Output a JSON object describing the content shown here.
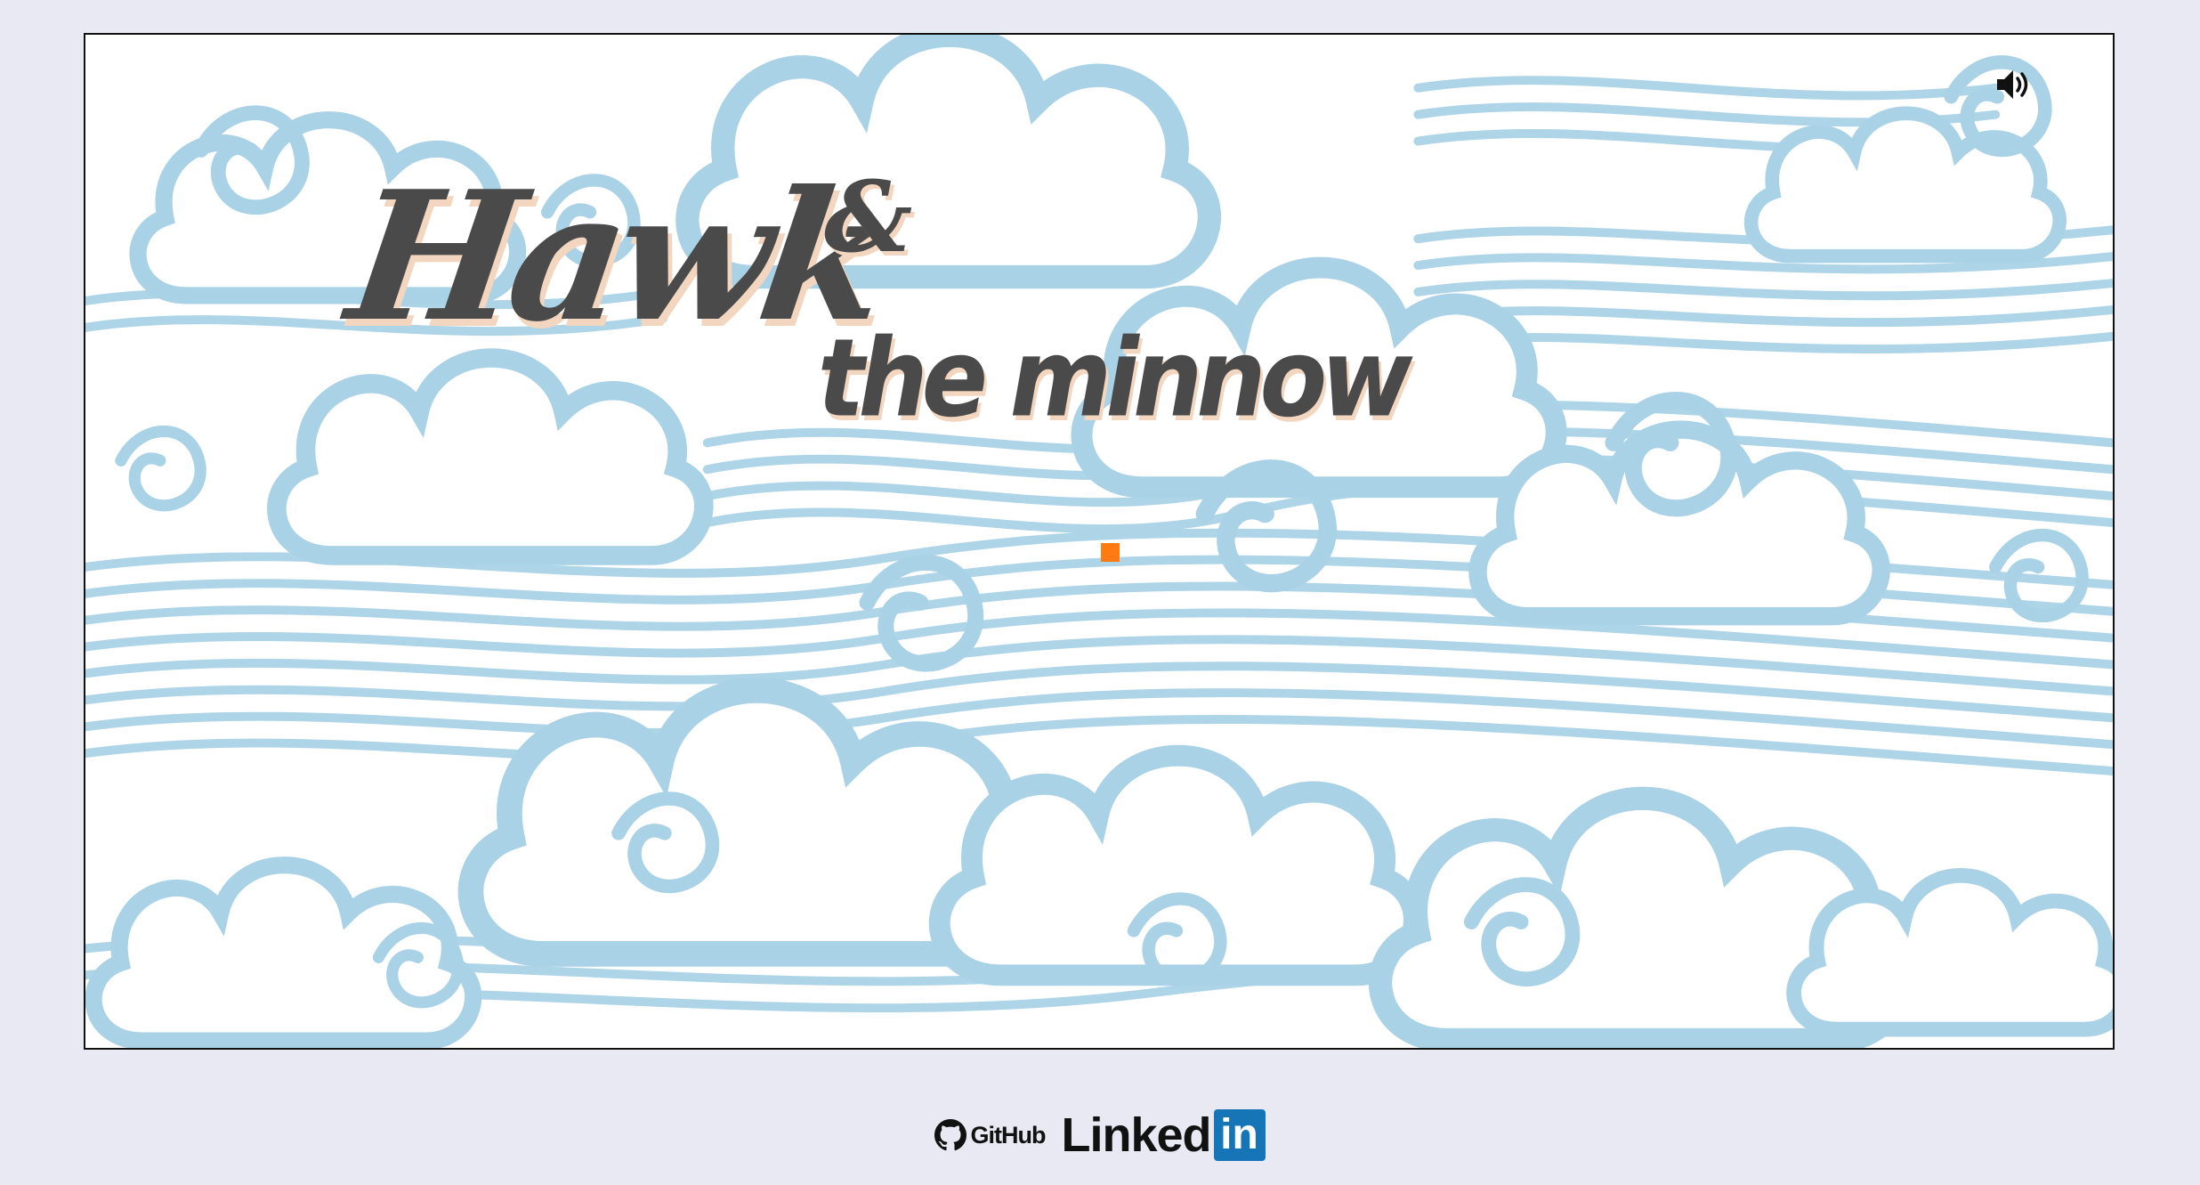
{
  "game": {
    "title_main": "Hawk",
    "title_amp": "&",
    "title_sub": "the minnow",
    "player_color": "#ff7a10",
    "background_pattern": "blue swirling clouds and waves",
    "pattern_color": "#9fcbe0"
  },
  "sound": {
    "icon": "speaker-icon"
  },
  "footer": {
    "github_label": "GitHub",
    "linkedin_label": "Linked",
    "linkedin_box": "in",
    "linkedin_color": "#1675b6"
  }
}
